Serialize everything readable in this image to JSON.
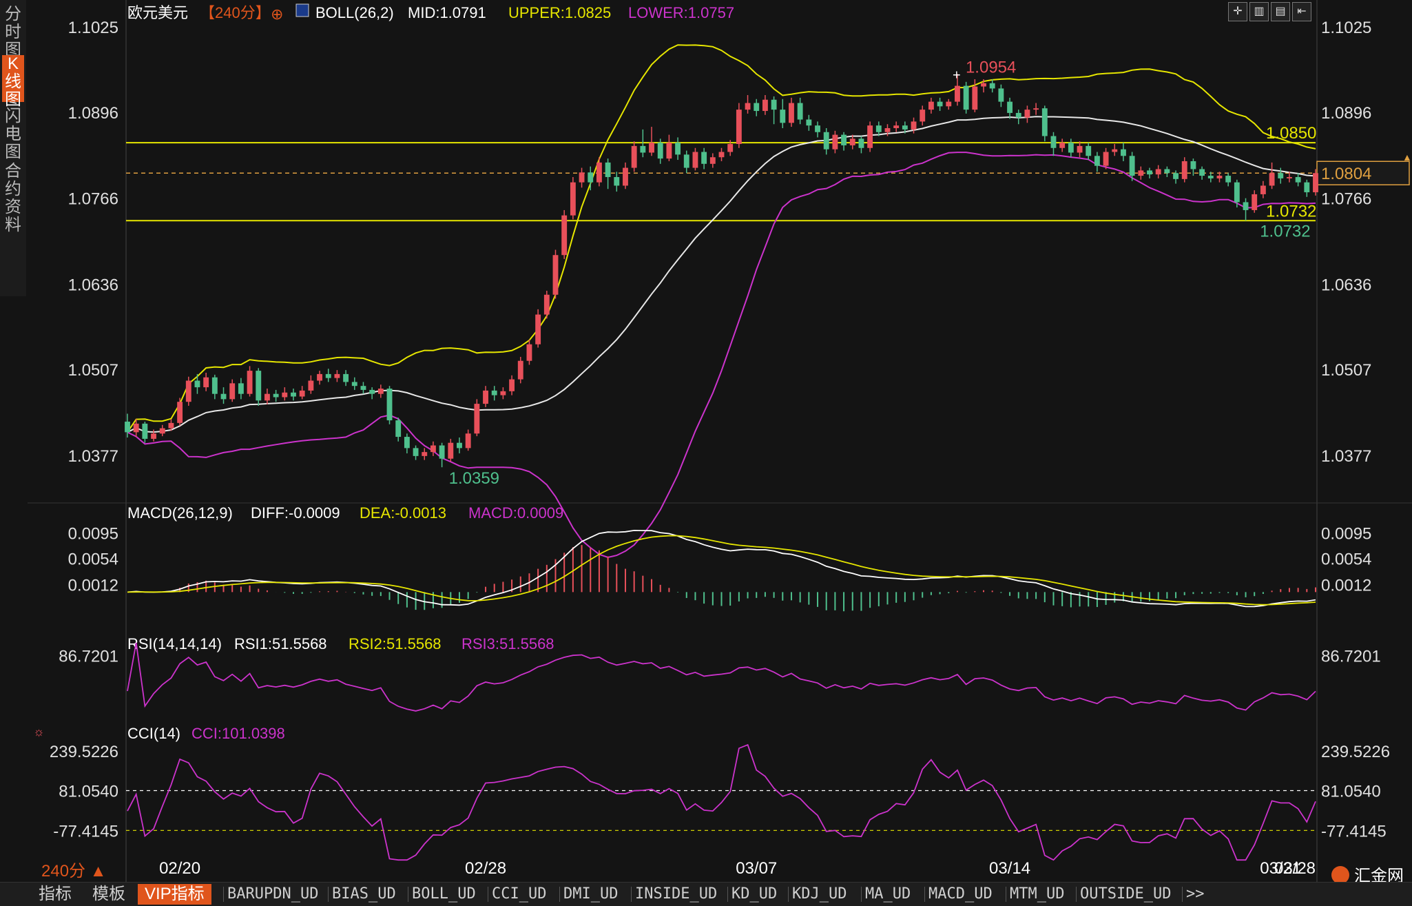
{
  "side_tabs": [
    "分时图",
    "K线图",
    "闪电图",
    "合约资料"
  ],
  "side_active": 1,
  "chart_data": {
    "type": "candlestick",
    "title": "欧元美元",
    "period": "【240分】",
    "boll": {
      "label": "BOLL(26,2)",
      "mid": "MID:1.0791",
      "upper": "UPPER:1.0825",
      "lower": "LOWER:1.0757"
    },
    "price_axis": {
      "ticks": [
        "1.1025",
        "1.0896",
        "1.0766",
        "1.0636",
        "1.0507",
        "1.0377"
      ],
      "ylim": [
        1.0305,
        1.1045
      ]
    },
    "x_dates": [
      "02/20",
      "02/28",
      "03/07",
      "03/14",
      "03/21",
      "03/28"
    ],
    "candles": [
      [
        1.0428,
        1.0412,
        1.044,
        1.0404
      ],
      [
        1.0412,
        1.0425,
        1.0432,
        1.0405
      ],
      [
        1.0425,
        1.0402,
        1.0428,
        1.0396
      ],
      [
        1.0402,
        1.041,
        1.0416,
        1.0398
      ],
      [
        1.041,
        1.0418,
        1.0423,
        1.0406
      ],
      [
        1.0418,
        1.0426,
        1.0432,
        1.0414
      ],
      [
        1.0426,
        1.0458,
        1.0464,
        1.0422
      ],
      [
        1.0458,
        1.049,
        1.0496,
        1.0452
      ],
      [
        1.049,
        1.048,
        1.05,
        1.047
      ],
      [
        1.048,
        1.0495,
        1.0502,
        1.0474
      ],
      [
        1.0495,
        1.047,
        1.0499,
        1.0462
      ],
      [
        1.047,
        1.0462,
        1.048,
        1.0455
      ],
      [
        1.0462,
        1.0486,
        1.0492,
        1.0458
      ],
      [
        1.0486,
        1.047,
        1.0494,
        1.0462
      ],
      [
        1.047,
        1.0505,
        1.0512,
        1.0466
      ],
      [
        1.0505,
        1.046,
        1.0509,
        1.0452
      ],
      [
        1.046,
        1.047,
        1.0478,
        1.0454
      ],
      [
        1.047,
        1.0465,
        1.0476,
        1.0458
      ],
      [
        1.0465,
        1.0472,
        1.048,
        1.046
      ],
      [
        1.0472,
        1.0466,
        1.0478,
        1.046
      ],
      [
        1.0466,
        1.0475,
        1.0482,
        1.0462
      ],
      [
        1.0475,
        1.049,
        1.0498,
        1.047
      ],
      [
        1.049,
        1.05,
        1.0505,
        1.0484
      ],
      [
        1.05,
        1.0494,
        1.0508,
        1.0488
      ],
      [
        1.0494,
        1.05,
        1.0506,
        1.0488
      ],
      [
        1.05,
        1.0488,
        1.0506,
        1.0482
      ],
      [
        1.0488,
        1.0482,
        1.0495,
        1.0476
      ],
      [
        1.0482,
        1.0476,
        1.0488,
        1.047
      ],
      [
        1.0476,
        1.047,
        1.048,
        1.0462
      ],
      [
        1.047,
        1.0478,
        1.0484,
        1.0464
      ],
      [
        1.0478,
        1.043,
        1.0482,
        1.0424
      ],
      [
        1.043,
        1.0405,
        1.0434,
        1.0398
      ],
      [
        1.0405,
        1.0388,
        1.041,
        1.038
      ],
      [
        1.0388,
        1.0376,
        1.0392,
        1.037
      ],
      [
        1.0376,
        1.0382,
        1.0388,
        1.037
      ],
      [
        1.0382,
        1.0392,
        1.0398,
        1.0376
      ],
      [
        1.0392,
        1.0372,
        1.0396,
        1.0359
      ],
      [
        1.0372,
        1.0396,
        1.0402,
        1.0368
      ],
      [
        1.0396,
        1.0388,
        1.0404,
        1.038
      ],
      [
        1.0388,
        1.041,
        1.0416,
        1.0384
      ],
      [
        1.041,
        1.0455,
        1.0462,
        1.0406
      ],
      [
        1.0455,
        1.0475,
        1.0482,
        1.045
      ],
      [
        1.0475,
        1.0468,
        1.0482,
        1.046
      ],
      [
        1.0468,
        1.0474,
        1.048,
        1.0462
      ],
      [
        1.0474,
        1.0492,
        1.0498,
        1.0468
      ],
      [
        1.0492,
        1.052,
        1.0526,
        1.0486
      ],
      [
        1.052,
        1.0545,
        1.0552,
        1.0514
      ],
      [
        1.0545,
        1.059,
        1.0598,
        1.054
      ],
      [
        1.059,
        1.062,
        1.0626,
        1.0584
      ],
      [
        1.062,
        1.068,
        1.0688,
        1.0614
      ],
      [
        1.068,
        1.074,
        1.0748,
        1.0674
      ],
      [
        1.074,
        1.079,
        1.0798,
        1.0734
      ],
      [
        1.079,
        1.0805,
        1.0812,
        1.0782
      ],
      [
        1.0805,
        1.079,
        1.0814,
        1.0778
      ],
      [
        1.079,
        1.082,
        1.0828,
        1.0784
      ],
      [
        1.082,
        1.0798,
        1.0826,
        1.078
      ],
      [
        1.0798,
        1.0785,
        1.0806,
        1.0776
      ],
      [
        1.0785,
        1.0812,
        1.082,
        1.078
      ],
      [
        1.0812,
        1.0845,
        1.0852,
        1.0806
      ],
      [
        1.0845,
        1.0835,
        1.087,
        1.0828
      ],
      [
        1.0835,
        1.085,
        1.0874,
        1.083
      ],
      [
        1.085,
        1.0826,
        1.0856,
        1.0818
      ],
      [
        1.0826,
        1.085,
        1.0862,
        1.0822
      ],
      [
        1.085,
        1.0832,
        1.0858,
        1.0824
      ],
      [
        1.0832,
        1.0812,
        1.0838,
        1.0804
      ],
      [
        1.0812,
        1.0836,
        1.0842,
        1.0808
      ],
      [
        1.0836,
        1.0818,
        1.0842,
        1.081
      ],
      [
        1.0818,
        1.0828,
        1.0834,
        1.0812
      ],
      [
        1.0828,
        1.0836,
        1.0842,
        1.0822
      ],
      [
        1.0836,
        1.0848,
        1.0854,
        1.083
      ],
      [
        1.0848,
        1.09,
        1.091,
        1.0842
      ],
      [
        1.09,
        1.091,
        1.0922,
        1.0894
      ],
      [
        1.091,
        1.0898,
        1.0916,
        1.089
      ],
      [
        1.0898,
        1.0915,
        1.0922,
        1.0892
      ],
      [
        1.0915,
        1.09,
        1.092,
        1.0878
      ],
      [
        1.09,
        1.088,
        1.0916,
        1.0872
      ],
      [
        1.088,
        1.091,
        1.0918,
        1.0874
      ],
      [
        1.091,
        1.0885,
        1.0918,
        1.0878
      ],
      [
        1.0885,
        1.0876,
        1.0892,
        1.0868
      ],
      [
        1.0876,
        1.0866,
        1.0882,
        1.0858
      ],
      [
        1.0866,
        1.084,
        1.0872,
        1.0832
      ],
      [
        1.084,
        1.0862,
        1.0868,
        1.0834
      ],
      [
        1.0862,
        1.0846,
        1.0866,
        1.0838
      ],
      [
        1.0846,
        1.0856,
        1.0862,
        1.084
      ],
      [
        1.0856,
        1.0842,
        1.086,
        1.0834
      ],
      [
        1.0842,
        1.0876,
        1.0882,
        1.0836
      ],
      [
        1.0876,
        1.0866,
        1.0882,
        1.086
      ],
      [
        1.0866,
        1.0872,
        1.0878,
        1.086
      ],
      [
        1.0872,
        1.0876,
        1.0882,
        1.0866
      ],
      [
        1.0876,
        1.087,
        1.0882,
        1.0864
      ],
      [
        1.087,
        1.0882,
        1.0888,
        1.0864
      ],
      [
        1.0882,
        1.09,
        1.0906,
        1.0876
      ],
      [
        1.09,
        1.0912,
        1.0918,
        1.0894
      ],
      [
        1.0912,
        1.0905,
        1.0918,
        1.0898
      ],
      [
        1.0905,
        1.0912,
        1.0916,
        1.09
      ],
      [
        1.0912,
        1.0936,
        1.0954,
        1.0906
      ],
      [
        1.0936,
        1.09,
        1.0942,
        1.0894
      ],
      [
        1.09,
        1.0935,
        1.0946,
        1.0896
      ],
      [
        1.0935,
        1.094,
        1.0946,
        1.0926
      ],
      [
        1.094,
        1.0932,
        1.0946,
        1.0926
      ],
      [
        1.0932,
        1.0912,
        1.0938,
        1.0904
      ],
      [
        1.0912,
        1.0895,
        1.0918,
        1.0886
      ],
      [
        1.0895,
        1.0888,
        1.09,
        1.0878
      ],
      [
        1.0888,
        1.09,
        1.0906,
        1.088
      ],
      [
        1.09,
        1.0902,
        1.091,
        1.0892
      ],
      [
        1.0902,
        1.086,
        1.0906,
        1.0852
      ],
      [
        1.086,
        1.0842,
        1.0866,
        1.083
      ],
      [
        1.0842,
        1.085,
        1.0856,
        1.0836
      ],
      [
        1.085,
        1.0835,
        1.0856,
        1.0828
      ],
      [
        1.0835,
        1.0845,
        1.0852,
        1.0828
      ],
      [
        1.0845,
        1.083,
        1.085,
        1.0824
      ],
      [
        1.083,
        1.0815,
        1.0836,
        1.0806
      ],
      [
        1.0815,
        1.0836,
        1.0842,
        1.081
      ],
      [
        1.0836,
        1.084,
        1.0848,
        1.083
      ],
      [
        1.084,
        1.083,
        1.085,
        1.0822
      ],
      [
        1.083,
        1.08,
        1.0836,
        1.0792
      ],
      [
        1.08,
        1.0808,
        1.0814,
        1.0794
      ],
      [
        1.0808,
        1.0802,
        1.0812,
        1.0796
      ],
      [
        1.0802,
        1.081,
        1.0816,
        1.0796
      ],
      [
        1.081,
        1.0804,
        1.0814,
        1.0798
      ],
      [
        1.0804,
        1.0795,
        1.0808,
        1.0788
      ],
      [
        1.0795,
        1.0822,
        1.0828,
        1.079
      ],
      [
        1.0822,
        1.081,
        1.0826,
        1.08
      ],
      [
        1.081,
        1.08,
        1.0814,
        1.0794
      ],
      [
        1.08,
        1.0796,
        1.0806,
        1.079
      ],
      [
        1.0796,
        1.08,
        1.0806,
        1.079
      ],
      [
        1.08,
        1.079,
        1.0804,
        1.0784
      ],
      [
        1.079,
        1.076,
        1.0794,
        1.0752
      ],
      [
        1.076,
        1.0748,
        1.0766,
        1.0732
      ],
      [
        1.0748,
        1.0772,
        1.0778,
        1.0744
      ],
      [
        1.0772,
        1.0785,
        1.0792,
        1.0766
      ],
      [
        1.0785,
        1.0804,
        1.082,
        1.078
      ],
      [
        1.0804,
        1.0796,
        1.0812,
        1.0788
      ],
      [
        1.0796,
        1.0798,
        1.0806,
        1.079
      ],
      [
        1.0798,
        1.079,
        1.0804,
        1.0784
      ],
      [
        1.079,
        1.0775,
        1.0794,
        1.0768
      ],
      [
        1.0775,
        1.0804,
        1.081,
        1.077
      ]
    ],
    "annotations": {
      "high": "1.0954",
      "low1": "1.0359",
      "low2": "1.0732",
      "level_upper": "1.0850",
      "level_lower": "1.0732",
      "current": "1.0804"
    },
    "macd": {
      "label": "MACD(26,12,9)",
      "diff": "DIFF:-0.0009",
      "dea": "DEA:-0.0013",
      "macd": "MACD:0.0009",
      "ticks": [
        "0.0095",
        "0.0054",
        "0.0012"
      ],
      "ylim": [
        -0.0045,
        0.011
      ]
    },
    "rsi": {
      "label": "RSI(14,14,14)",
      "rsi1": "RSI1:51.5568",
      "rsi2": "RSI2:51.5568",
      "rsi3": "RSI3:51.5568",
      "tick": "86.7201",
      "ylim": [
        20,
        95
      ]
    },
    "cci": {
      "label": "CCI(14)",
      "cci": "CCI:101.0398",
      "ticks": [
        "239.5226",
        "81.0540",
        "-77.4145"
      ],
      "ylim": [
        -200,
        280
      ]
    }
  },
  "bottom_tabs": [
    "指标",
    "模板",
    "VIP指标",
    "BARUPDN_UD",
    "BIAS_UD",
    "BOLL_UD",
    "CCI_UD",
    "DMI_UD",
    "INSIDE_UD",
    "KD_UD",
    "KDJ_UD",
    "MA_UD",
    "MACD_UD",
    "MTM_UD",
    "OUTSIDE_UD",
    ">>"
  ],
  "period_label": "240分",
  "logo": "汇金网",
  "colors": {
    "up": "#e8505a",
    "down": "#4fc08d",
    "upper": "#e6e600",
    "mid": "#e8e8e8",
    "lower": "#cc33cc",
    "dea": "#e6e600",
    "level": "#e6e600",
    "current": "#e0a040"
  }
}
